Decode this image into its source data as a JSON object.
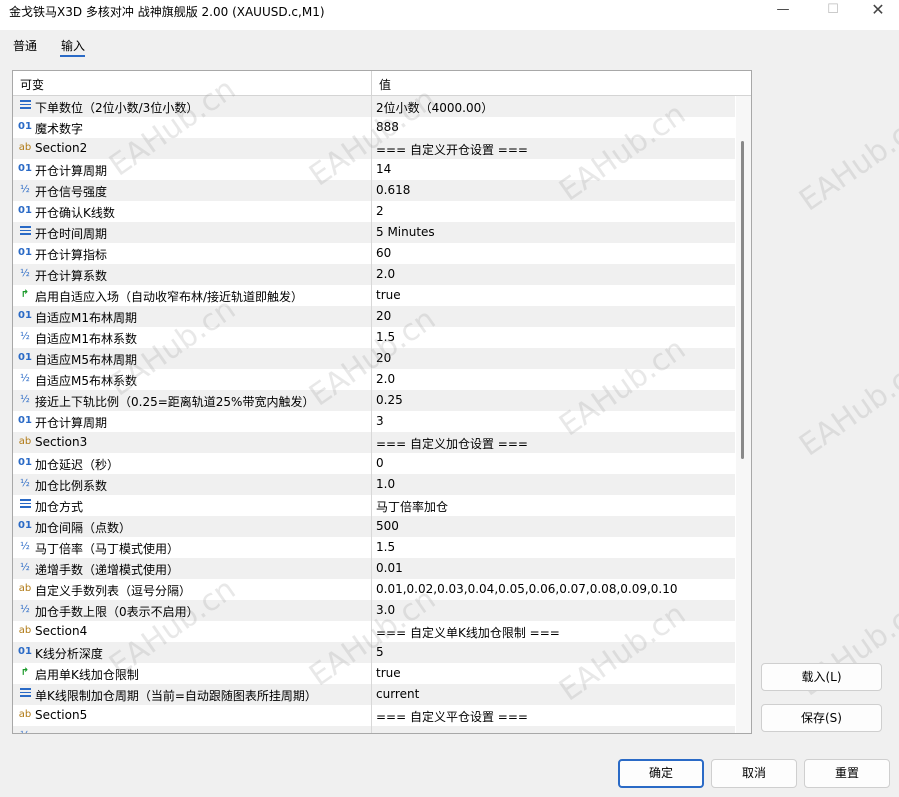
{
  "window": {
    "title": "金戈铁马X3D 多核对冲 战神旗舰版 2.00 (XAUUSD.c,M1)",
    "minimize": "—",
    "maximize": "☐",
    "close": "✕"
  },
  "tabs": [
    {
      "label": "普通"
    },
    {
      "label": "输入"
    }
  ],
  "grid": {
    "header": {
      "col1": "可变",
      "col2": "值"
    },
    "rows": [
      {
        "icon": "enum-icon",
        "name": "下单数位（2位小数/3位小数）",
        "value": "2位小数（4000.00）"
      },
      {
        "icon": "int-icon",
        "name": "魔术数字",
        "value": "888"
      },
      {
        "icon": "string-icon",
        "name": "Section2",
        "value": "=== 自定义开仓设置 ==="
      },
      {
        "icon": "int-icon",
        "name": "开仓计算周期",
        "value": "14"
      },
      {
        "icon": "double-icon",
        "name": "开仓信号强度",
        "value": "0.618"
      },
      {
        "icon": "int-icon",
        "name": "开仓确认K线数",
        "value": "2"
      },
      {
        "icon": "enum-icon",
        "name": "开仓时间周期",
        "value": "5 Minutes"
      },
      {
        "icon": "int-icon",
        "name": "开仓计算指标",
        "value": "60"
      },
      {
        "icon": "double-icon",
        "name": "开仓计算系数",
        "value": "2.0"
      },
      {
        "icon": "bool-icon",
        "name": "启用自适应入场（自动收窄布林/接近轨道即触发）",
        "value": "true"
      },
      {
        "icon": "int-icon",
        "name": "自适应M1布林周期",
        "value": "20"
      },
      {
        "icon": "double-icon",
        "name": "自适应M1布林系数",
        "value": "1.5"
      },
      {
        "icon": "int-icon",
        "name": "自适应M5布林周期",
        "value": "20"
      },
      {
        "icon": "double-icon",
        "name": "自适应M5布林系数",
        "value": "2.0"
      },
      {
        "icon": "double-icon",
        "name": "接近上下轨比例（0.25=距离轨道25%带宽内触发）",
        "value": "0.25"
      },
      {
        "icon": "int-icon",
        "name": "开仓计算周期",
        "value": "3"
      },
      {
        "icon": "string-icon",
        "name": "Section3",
        "value": "=== 自定义加仓设置 ==="
      },
      {
        "icon": "int-icon",
        "name": "加仓延迟（秒）",
        "value": "0"
      },
      {
        "icon": "double-icon",
        "name": "加仓比例系数",
        "value": "1.0"
      },
      {
        "icon": "enum-icon",
        "name": "加仓方式",
        "value": "马丁倍率加仓"
      },
      {
        "icon": "int-icon",
        "name": "加仓间隔（点数）",
        "value": "500"
      },
      {
        "icon": "double-icon",
        "name": "马丁倍率（马丁模式使用）",
        "value": "1.5"
      },
      {
        "icon": "double-icon",
        "name": "递增手数（递增模式使用）",
        "value": "0.01"
      },
      {
        "icon": "string-icon",
        "name": "自定义手数列表（逗号分隔）",
        "value": "0.01,0.02,0.03,0.04,0.05,0.06,0.07,0.08,0.09,0.10"
      },
      {
        "icon": "double-icon",
        "name": "加仓手数上限（0表示不启用）",
        "value": "3.0"
      },
      {
        "icon": "string-icon",
        "name": "Section4",
        "value": "=== 自定义单K线加仓限制 ==="
      },
      {
        "icon": "int-icon",
        "name": "K线分析深度",
        "value": "5"
      },
      {
        "icon": "bool-icon",
        "name": "启用单K线加仓限制",
        "value": "true"
      },
      {
        "icon": "enum-icon",
        "name": "单K线限制加仓周期（当前=自动跟随图表所挂周期）",
        "value": "current"
      },
      {
        "icon": "string-icon",
        "name": "Section5",
        "value": "=== 自定义平仓设置 ==="
      },
      {
        "icon": "double-icon",
        "name": "",
        "value": ""
      }
    ]
  },
  "watermark_text": "EAHub.cn",
  "buttons": {
    "load": "载入(L)",
    "save": "保存(S)",
    "ok": "确定",
    "cancel": "取消",
    "reset": "重置"
  },
  "colors": {
    "accent": "#2a6ac6",
    "string_icon": "#b07a16",
    "bool_icon": "#1a9a2a",
    "alt_row": "#f0f0f0"
  }
}
